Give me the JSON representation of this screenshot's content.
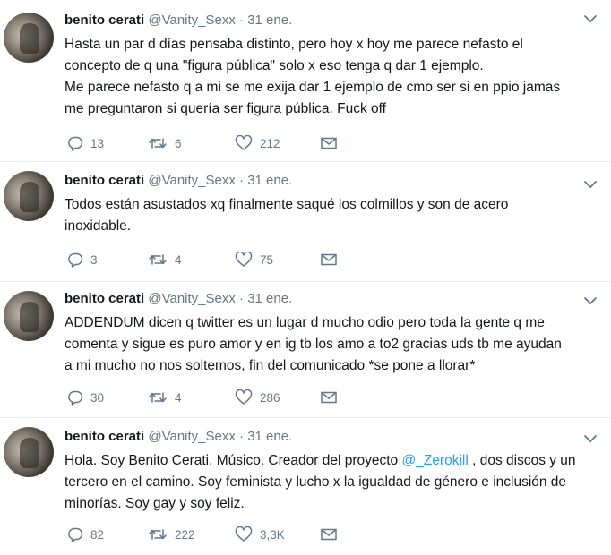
{
  "tweets": [
    {
      "name": "benito cerati",
      "handle": "@Vanity_Sexx",
      "separator": "·",
      "date": "31 ene.",
      "text_lines": [
        "Hasta un par d días pensaba distinto, pero hoy x hoy me parece nefasto el",
        "concepto de q una \"figura pública\" solo x eso tenga q dar 1 ejemplo.",
        "Me parece nefasto q a mi se me exija dar 1 ejemplo de cmo ser si en ppio jamas",
        "me preguntaron si quería ser figura pública. Fuck off"
      ],
      "replies": "13",
      "retweets": "6",
      "likes": "212"
    },
    {
      "name": "benito cerati",
      "handle": "@Vanity_Sexx",
      "separator": "·",
      "date": "31 ene.",
      "text_lines": [
        "Todos están asustados xq finalmente saqué los colmillos y son de acero",
        "inoxidable."
      ],
      "replies": "3",
      "retweets": "4",
      "likes": "75"
    },
    {
      "name": "benito cerati",
      "handle": "@Vanity_Sexx",
      "separator": "·",
      "date": "31 ene.",
      "text_lines": [
        "ADDENDUM dicen q twitter es un lugar d mucho odio pero toda la gente q me",
        "comenta y sigue es puro amor y en ig tb los amo a to2 gracias uds tb me ayudan",
        "a mi mucho no nos soltemos, fin del comunicado *se pone a llorar*"
      ],
      "replies": "30",
      "retweets": "4",
      "likes": "286"
    },
    {
      "name": "benito cerati",
      "handle": "@Vanity_Sexx",
      "separator": "·",
      "date": "31 ene.",
      "text_line1_before": "Hola. Soy Benito Cerati. Músico. Creador del proyecto ",
      "text_line1_mention": "@_Zerokill",
      "text_line1_after": " , dos discos y un",
      "text_lines_rest": [
        "tercero en el camino. Soy feminista y lucho x la igualdad de género e inclusión de",
        "minorías. Soy gay y soy feliz."
      ],
      "replies": "82",
      "retweets": "222",
      "likes": "3,3K"
    }
  ],
  "icons": {
    "reply": "reply-icon",
    "retweet": "retweet-icon",
    "like": "heart-icon",
    "dm": "envelope-icon",
    "menu": "chevron-down-icon"
  },
  "colors": {
    "text": "#14171a",
    "secondary": "#657786",
    "link": "#1da1f2",
    "divider": "#e6ecf0"
  }
}
